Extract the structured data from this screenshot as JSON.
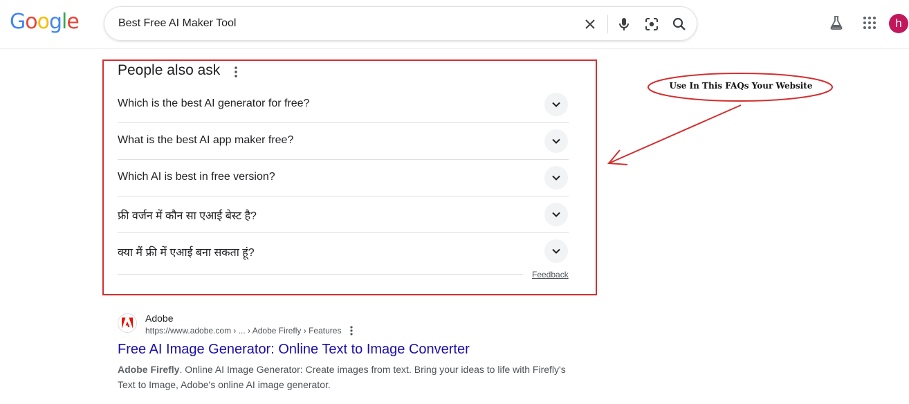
{
  "header": {
    "logo_text": "Google",
    "search_query": "Best Free AI Maker Tool",
    "avatar_letter": "h",
    "icons": [
      "close-icon",
      "mic-icon",
      "lens-icon",
      "search-icon",
      "labs-flask-icon",
      "apps-grid-icon"
    ]
  },
  "paa": {
    "title": "People also ask",
    "questions": [
      "Which is the best AI generator for free?",
      "What is the best AI app maker free?",
      "Which AI is best in free version?",
      "फ्री वर्जन में कौन सा एआई बेस्ट है?",
      "क्या मैं फ्री में एआई बना सकता हूं?"
    ],
    "feedback": "Feedback"
  },
  "annotation": {
    "text": "Use In This FAQs Your Website",
    "color": "#d32f2f"
  },
  "result": {
    "site_name": "Adobe",
    "url": "https://www.adobe.com › ... › Adobe Firefly › Features",
    "title": "Free AI Image Generator: Online Text to Image Converter",
    "snippet_bold": "Adobe Firefly",
    "snippet_rest": ". Online AI Image Generator: Create images from text. Bring your ideas to life with Firefly's Text to Image, Adobe's online AI image generator."
  },
  "colors": {
    "link": "#1a0dab",
    "frame_red": "#d32f2f",
    "avatar": "#c2185b"
  }
}
